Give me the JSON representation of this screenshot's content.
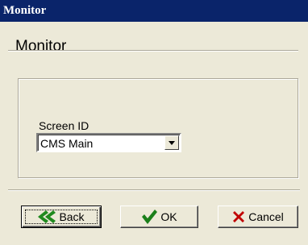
{
  "window": {
    "title": "Monitor"
  },
  "header": {
    "title": "Monitor"
  },
  "form": {
    "screen_id_label": "Screen ID",
    "screen_id_value": "CMS Main"
  },
  "buttons": {
    "back_label": "Back",
    "ok_label": "OK",
    "cancel_label": "Cancel"
  },
  "icons": {
    "back": "double-chevron-left-icon",
    "ok": "checkmark-icon",
    "cancel": "x-cross-icon",
    "dropdown": "triangle-down-icon"
  },
  "colors": {
    "titlebar": "#0a246a",
    "dialog_bg": "#ece9d8",
    "back_icon": "#1f8a1f",
    "ok_icon": "#1a7f1a",
    "cancel_icon": "#c00000"
  }
}
